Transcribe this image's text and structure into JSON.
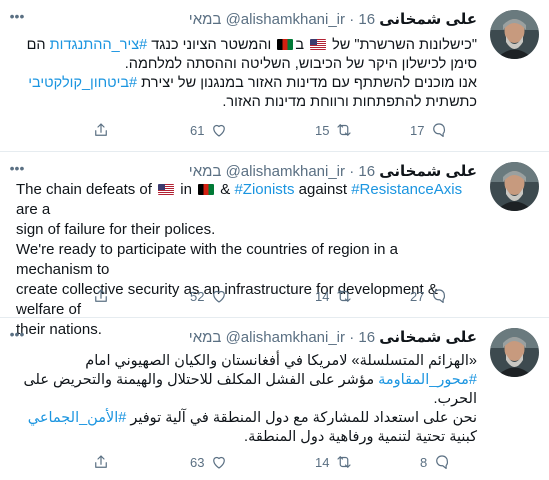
{
  "tweets": [
    {
      "name": "علی شمخانی",
      "handle": "@alishamkhani_ir",
      "dot": "·",
      "date": "16 במאי",
      "lines": [
        [
          "\"כישלונות השרשרת\" של ",
          {
            "flag": "us"
          },
          " ב",
          {
            "flag": "af"
          },
          " והמשטר הציוני כנגד ",
          {
            "tag": "#ציר_ההתנגדות"
          },
          " הם"
        ],
        [
          "סימן לכישלון היקר של הכיבוש, השליטה וההסתה למלחמה."
        ],
        [
          "אנו מוכנים להשתתף עם מדינות האזור במנגנון של יצירת ",
          {
            "tag": "#ביטחון_קולקטיבי"
          }
        ],
        [
          "כתשתית להתפתחות ורווחת מדינות האזור."
        ]
      ],
      "replies": "17",
      "retweets": "15",
      "likes": "61"
    },
    {
      "name": "علی شمخانی",
      "handle": "@alishamkhani_ir",
      "dot": "·",
      "date": "16 במאי",
      "lines": [
        [
          "The chain defeats of ",
          {
            "flag": "us"
          },
          " in ",
          {
            "flag": "af"
          },
          " & ",
          {
            "tag": "#Zionists"
          },
          " against ",
          {
            "tag": "#ResistanceAxis"
          },
          " are a"
        ],
        [
          "sign of failure for their polices."
        ],
        [
          "We're ready to participate with the countries of region in a mechanism to"
        ],
        [
          "create collective security as an infrastructure for development & welfare of"
        ],
        [
          "their nations."
        ]
      ],
      "replies": "27",
      "retweets": "14",
      "likes": "52"
    },
    {
      "name": "علی شمخانی",
      "handle": "@alishamkhani_ir",
      "dot": "·",
      "date": "16 במאי",
      "lines": [
        [
          "«الهزائم المتسلسلة» لامريكا في أفغانستان والكيان الصهيوني امام"
        ],
        [
          {
            "tag": "#محور_المقاومة"
          },
          " مؤشر على الفشل المكلف للاحتلال والهيمنة والتحريض على"
        ],
        [
          "الحرب."
        ],
        [
          "نحن على استعداد للمشاركة مع دول المنطقة في آلية توفير ",
          {
            "tag": "#الأمن_الجماعي"
          }
        ],
        [
          "كبنية تحتية لتنمية ورفاهية دول المنطقة."
        ]
      ],
      "replies": "8",
      "retweets": "14",
      "likes": "63"
    }
  ],
  "icons": {
    "more": "more-dots-icon",
    "reply": "reply-icon",
    "retweet": "retweet-icon",
    "like": "like-icon",
    "share": "share-icon"
  },
  "colors": {
    "hashtag": "#1b95e0",
    "muted": "#5b7083",
    "divider": "#e6ecf0"
  }
}
